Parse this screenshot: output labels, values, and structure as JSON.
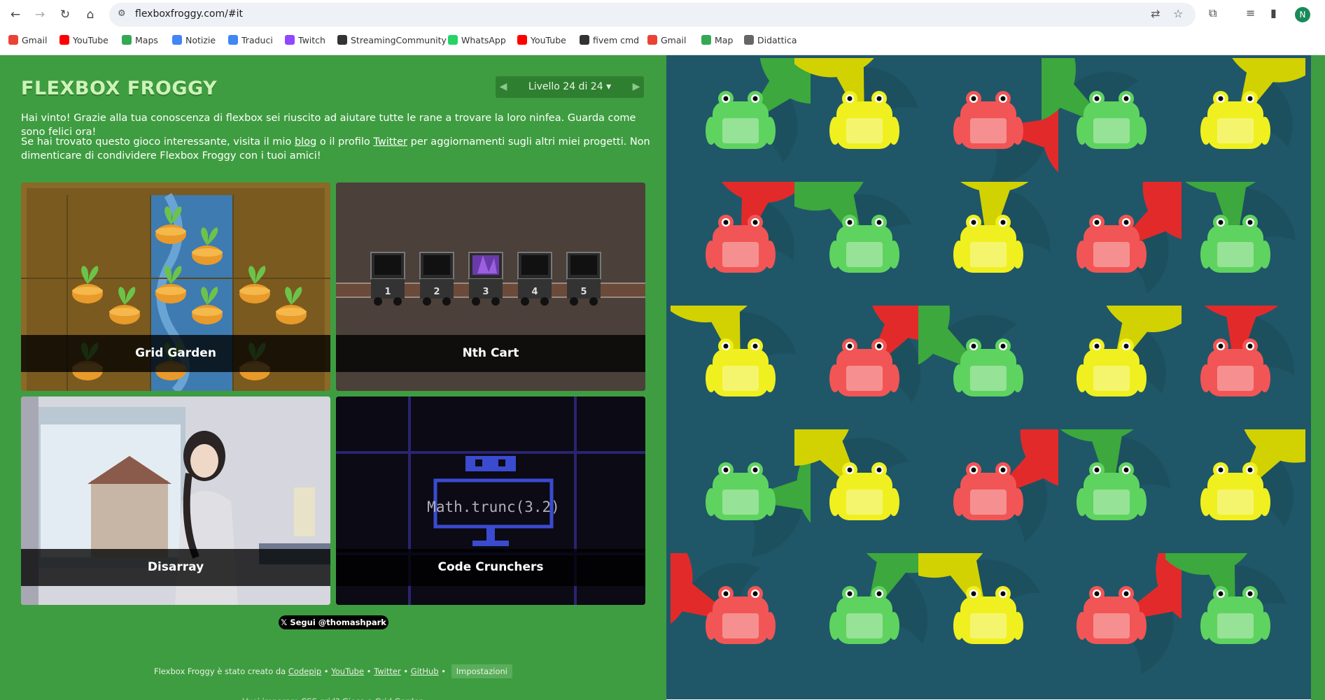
{
  "browser": {
    "url": "flexboxfroggy.com/#it",
    "avatar_letter": "N",
    "bookmarks": [
      {
        "label": "Gmail",
        "color": "#ea4335"
      },
      {
        "label": "YouTube",
        "color": "#ff0000"
      },
      {
        "label": "Maps",
        "color": "#34a853"
      },
      {
        "label": "Notizie",
        "color": "#4285f4"
      },
      {
        "label": "Traduci",
        "color": "#4285f4"
      },
      {
        "label": "Twitch",
        "color": "#9146ff"
      },
      {
        "label": "StreamingCommunity",
        "color": "#333333"
      },
      {
        "label": "WhatsApp",
        "color": "#25d366"
      },
      {
        "label": "YouTube",
        "color": "#ff0000"
      },
      {
        "label": "fivem cmd",
        "color": "#333333"
      },
      {
        "label": "Gmail",
        "color": "#ea4335"
      },
      {
        "label": "Map",
        "color": "#34a853"
      },
      {
        "label": "Didattica",
        "color": "#666666"
      }
    ]
  },
  "game": {
    "title": "FLEXBOX FROGGY",
    "level": {
      "label": "Livello 24 di 24",
      "prev": "◀",
      "next": "▶",
      "caret": "▾"
    },
    "win_message": "Hai vinto! Grazie alla tua conoscenza di flexbox sei riuscito ad aiutare tutte le rane a trovare la loro ninfea. Guarda come sono felici ora!",
    "promo": {
      "before": "Se hai trovato questo gioco interessante, visita il mio ",
      "blog": "blog",
      "middle": " o il profilo ",
      "twitter": "Twitter",
      "after": " per aggiornamenti sugli altri miei progetti. Non dimenticare di condividere Flexbox Froggy con i tuoi amici!"
    },
    "cards": [
      {
        "name": "Grid Garden"
      },
      {
        "name": "Nth Cart",
        "carts": [
          "1",
          "2",
          "3",
          "4",
          "5"
        ]
      },
      {
        "name": "Disarray"
      },
      {
        "name": "Code Crunchers",
        "code": "Math.trunc(3.2)"
      }
    ],
    "follow_button": "𝕏 Segui @thomashpark",
    "footer": {
      "created_by": "Flexbox Froggy è stato creato da",
      "links": [
        "Codepip",
        "YouTube",
        "Twitter",
        "GitHub"
      ],
      "separator": "•",
      "settings": "Impostazioni",
      "grid_promo": "Vuoi imparare CSS grid? Gioca a Grid Garden"
    }
  },
  "board": {
    "colors": {
      "green": "#3da83d",
      "yellow": "#d2d203",
      "red": "#e32a2a",
      "water": "#1f5768"
    },
    "frog_colors": {
      "green": "#5fd35f",
      "yellow": "#f0f020",
      "red": "#f25555"
    },
    "grid": [
      [
        "green",
        "yellow",
        "red",
        "green",
        "yellow"
      ],
      [
        "red",
        "green",
        "yellow",
        "red",
        "green"
      ],
      [
        "yellow",
        "red",
        "green",
        "yellow",
        "red"
      ],
      [
        "green",
        "yellow",
        "red",
        "green",
        "yellow"
      ],
      [
        "red",
        "green",
        "yellow",
        "red",
        "green"
      ]
    ]
  }
}
